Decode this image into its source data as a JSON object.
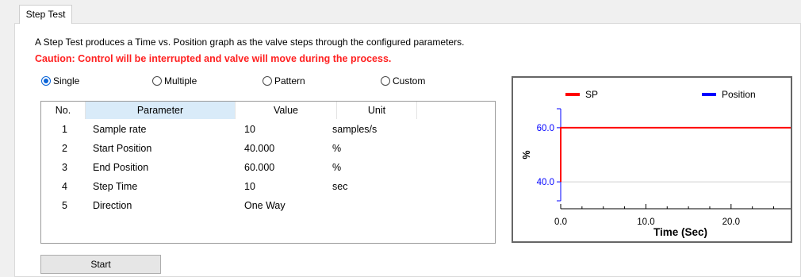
{
  "tab": {
    "label": "Step Test"
  },
  "intro": "A Step Test produces a Time vs. Position graph as the valve steps through the configured parameters.",
  "caution": "Caution: Control will be interrupted and valve will move during the process.",
  "modes": [
    {
      "label": "Single",
      "selected": true
    },
    {
      "label": "Multiple",
      "selected": false
    },
    {
      "label": "Pattern",
      "selected": false
    },
    {
      "label": "Custom",
      "selected": false
    }
  ],
  "table": {
    "headers": [
      "No.",
      "Parameter",
      "Value",
      "Unit"
    ],
    "rows": [
      [
        "1",
        "Sample rate",
        "10",
        "samples/s"
      ],
      [
        "2",
        "Start Position",
        "40.000",
        "%"
      ],
      [
        "3",
        "End Position",
        "60.000",
        "%"
      ],
      [
        "4",
        "Step Time",
        "10",
        "sec"
      ],
      [
        "5",
        "Direction",
        "One Way",
        ""
      ]
    ]
  },
  "start_button": "Start",
  "chart_data": {
    "type": "line",
    "xlabel": "Time (Sec)",
    "ylabel": "%",
    "y_ticks": [
      "60.0",
      "40.0"
    ],
    "x_ticks": [
      "0.0",
      "10.0",
      "20.0"
    ],
    "x_tick_values": [
      0,
      10,
      20
    ],
    "y_tick_values": [
      60,
      40
    ],
    "series": [
      {
        "name": "SP",
        "color": "#ff0000",
        "x": [
          0,
          0,
          27
        ],
        "y": [
          40,
          60,
          60
        ]
      },
      {
        "name": "Position",
        "color": "#0000ff",
        "x": [],
        "y": []
      }
    ],
    "xlim": [
      0,
      27
    ],
    "ylim": [
      33,
      67
    ],
    "legend": "top",
    "grid": true
  }
}
